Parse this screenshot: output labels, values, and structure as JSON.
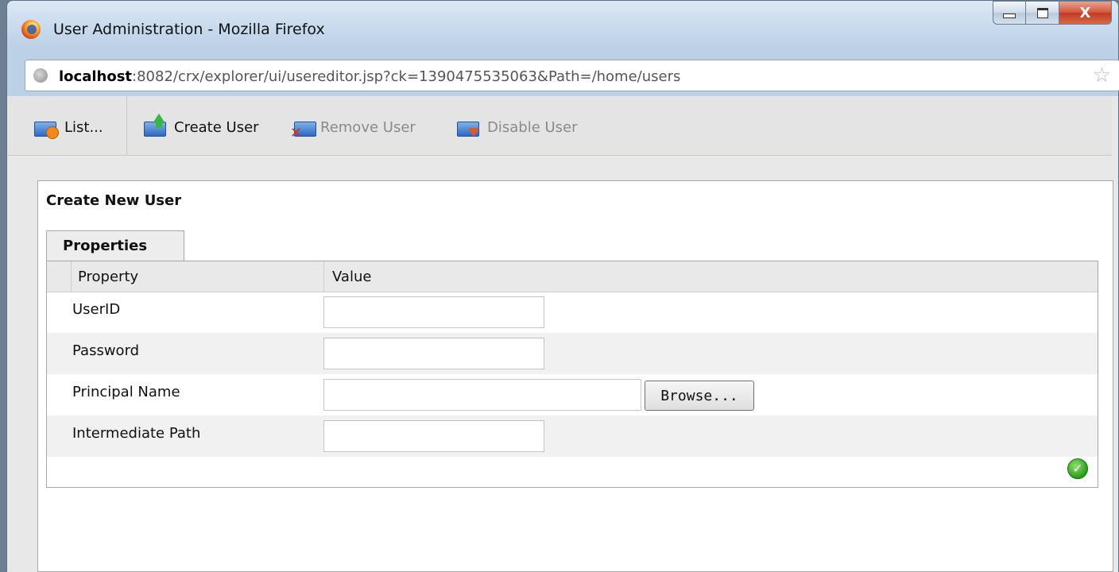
{
  "window": {
    "title": "User Administration - Mozilla Firefox",
    "controls": {
      "close_glyph": "X"
    }
  },
  "address_bar": {
    "host": "localhost",
    "rest": ":8082/crx/explorer/ui/usereditor.jsp?ck=1390475535063&Path=/home/users"
  },
  "toolbar": {
    "items": [
      {
        "label": "List...",
        "icon": "list-users-icon",
        "enabled": true
      },
      {
        "label": "Create User",
        "icon": "create-user-icon",
        "enabled": true
      },
      {
        "label": "Remove User",
        "icon": "remove-user-icon",
        "enabled": false
      },
      {
        "label": "Disable User",
        "icon": "disable-user-icon",
        "enabled": false
      }
    ]
  },
  "panel": {
    "title": "Create New User",
    "tab": "Properties",
    "columns": {
      "property": "Property",
      "value": "Value"
    },
    "rows": [
      {
        "label": "UserID",
        "value": ""
      },
      {
        "label": "Password",
        "value": ""
      },
      {
        "label": "Principal Name",
        "value": ""
      },
      {
        "label": "Intermediate Path",
        "value": ""
      }
    ],
    "browse_label": "Browse...",
    "status_icon": "ok-check-icon"
  }
}
